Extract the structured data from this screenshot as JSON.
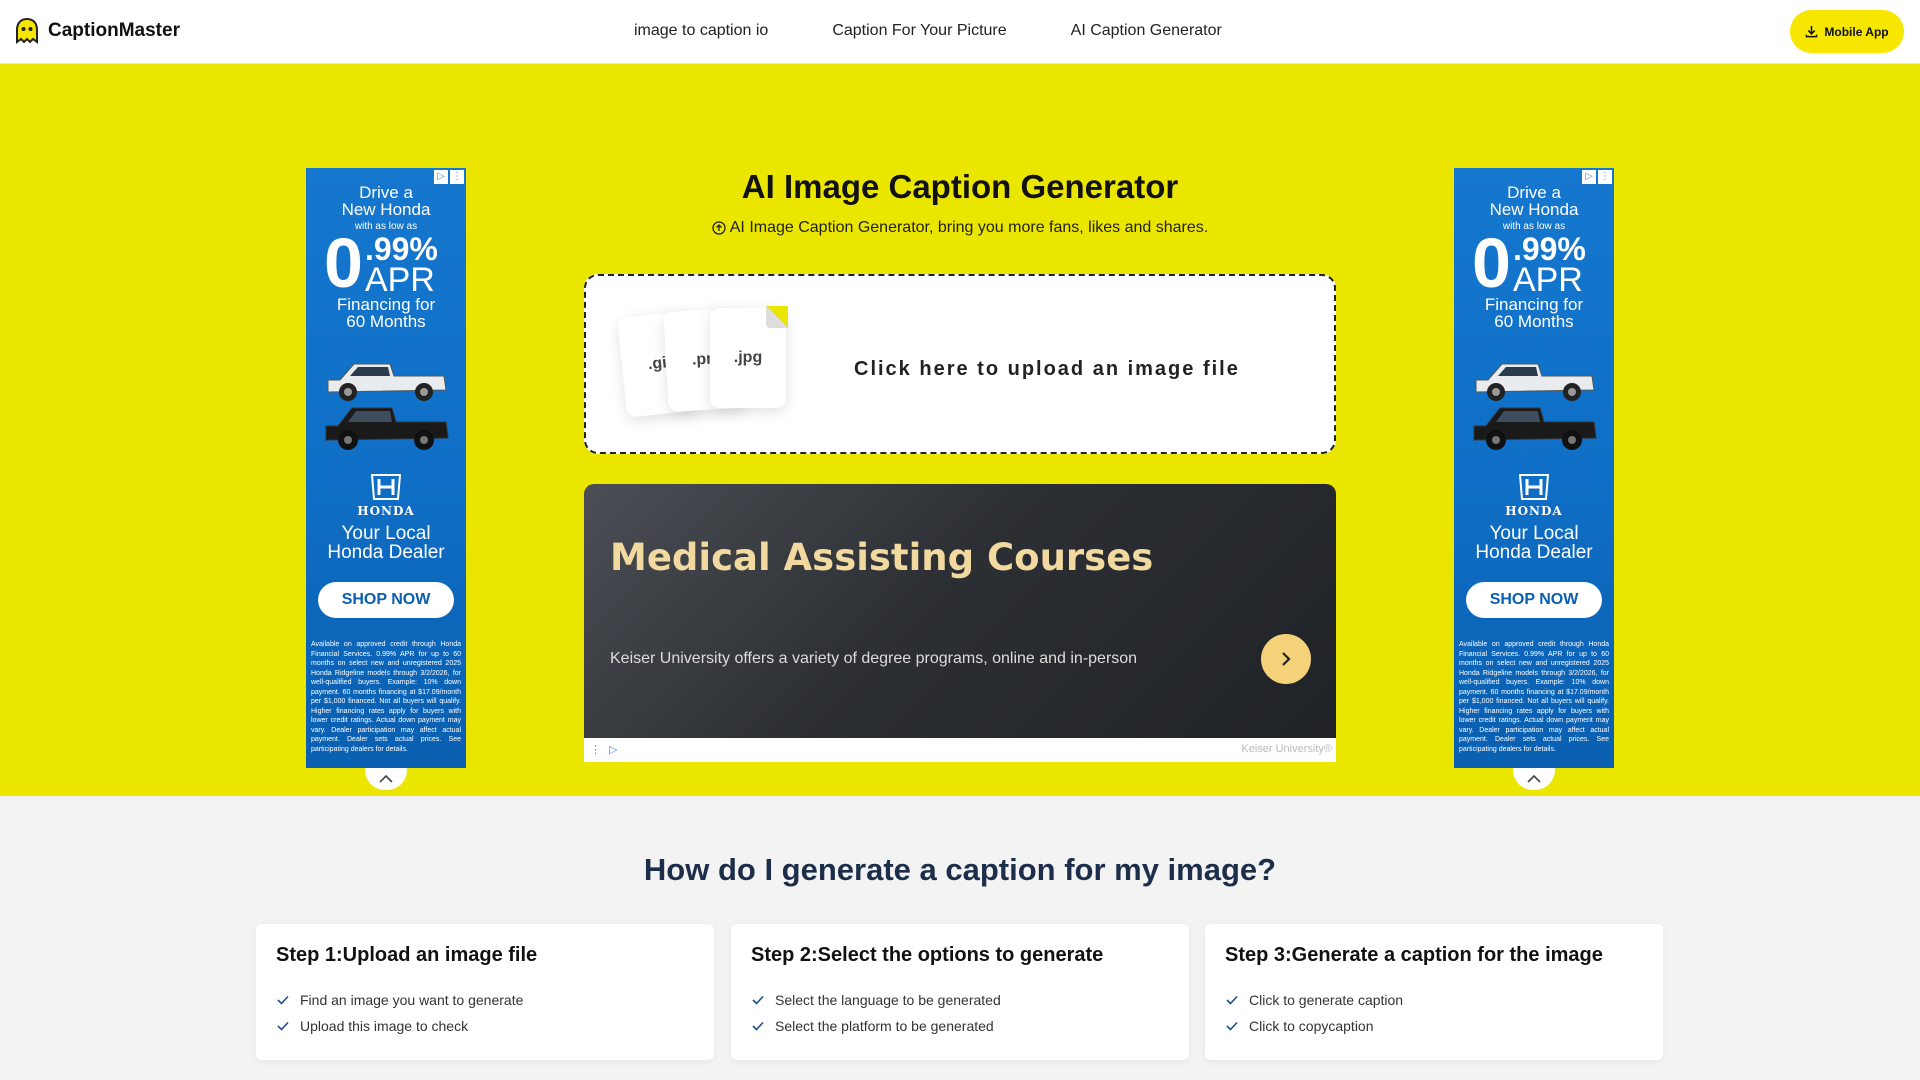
{
  "header": {
    "logo_text": "CaptionMaster",
    "nav": [
      "image to caption io",
      "Caption For Your Picture",
      "AI Caption Generator"
    ],
    "mobile_btn": "Mobile App"
  },
  "hero": {
    "title": "AI Image Caption Generator",
    "subtitle": "AI Image Caption Generator, bring you more fans, likes and shares.",
    "upload_text": "Click here to upload an image file",
    "file_types": [
      ".gif",
      ".pn",
      ".jpg"
    ],
    "bg_color": "#ebe600"
  },
  "ad_banner": {
    "title": "Medical Assisting Courses",
    "description": "Keiser University offers a variety of degree programs, online and in-person",
    "sponsor": "Keiser University®"
  },
  "side_ad": {
    "line1": "Drive a",
    "line2": "New Honda",
    "small": "with as low as",
    "zero": "0",
    "pct": ".99%",
    "apr": "APR",
    "fin1": "Financing for",
    "fin2": "60 Months",
    "brand": "HONDA",
    "dealer1": "Your Local",
    "dealer2": "Honda Dealer",
    "shop": "SHOP NOW",
    "fine": "Available on approved credit through Honda Financial Services. 0.99% APR for up to 60 months on select new and unregistered 2025 Honda Ridgeline models through 3/2/2026, for well-qualified buyers. Example: 10% down payment. 60 months financing at $17.09/month per $1,000 financed. Not all buyers will qualify. Higher financing rates apply for buyers with lower credit ratings. Actual down payment may vary. Dealer participation may affect actual payment. Dealer sets actual prices. See participating dealers for details."
  },
  "how": {
    "title": "How do I generate a caption for my image?",
    "steps": [
      {
        "title": "Step 1:Upload an image file",
        "items": [
          "Find an image you want to generate",
          "Upload this image to check"
        ]
      },
      {
        "title": "Step 2:Select the options to generate",
        "items": [
          "Select the language to be generated",
          "Select the platform to be generated"
        ]
      },
      {
        "title": "Step 3:Generate a caption for the image",
        "items": [
          "Click to generate caption",
          "Click to copycaption"
        ]
      }
    ]
  }
}
